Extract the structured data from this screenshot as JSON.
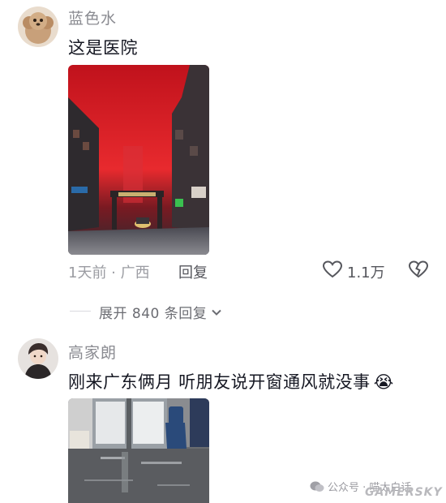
{
  "comments": [
    {
      "username": "蓝色水",
      "text": "这是医院",
      "time_location": "1天前 · 广西",
      "reply_label": "回复",
      "like_count": "1.1万",
      "expand_label": "展开 840 条回复"
    },
    {
      "username": "高家朗",
      "text": "刚来广东俩月 听朋友说开窗通风就没事",
      "emoji": "😭"
    }
  ],
  "watermark": {
    "account_label": "公众号 · 喵太白话",
    "site_logo": "GAMERSKY"
  },
  "icons": {
    "like": "heart-outline-icon",
    "dislike": "broken-heart-icon",
    "expand": "chevron-down-icon",
    "account": "wechat-icon"
  }
}
